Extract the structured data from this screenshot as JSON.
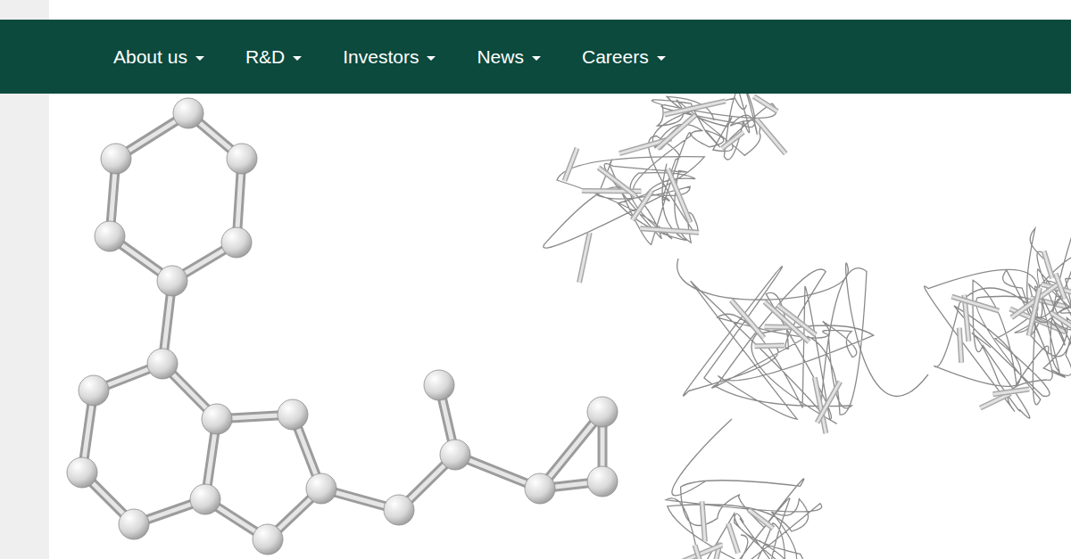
{
  "nav": {
    "items": [
      {
        "label": "About us"
      },
      {
        "label": "R&D"
      },
      {
        "label": "Investors"
      },
      {
        "label": "News"
      },
      {
        "label": "Careers"
      }
    ]
  }
}
